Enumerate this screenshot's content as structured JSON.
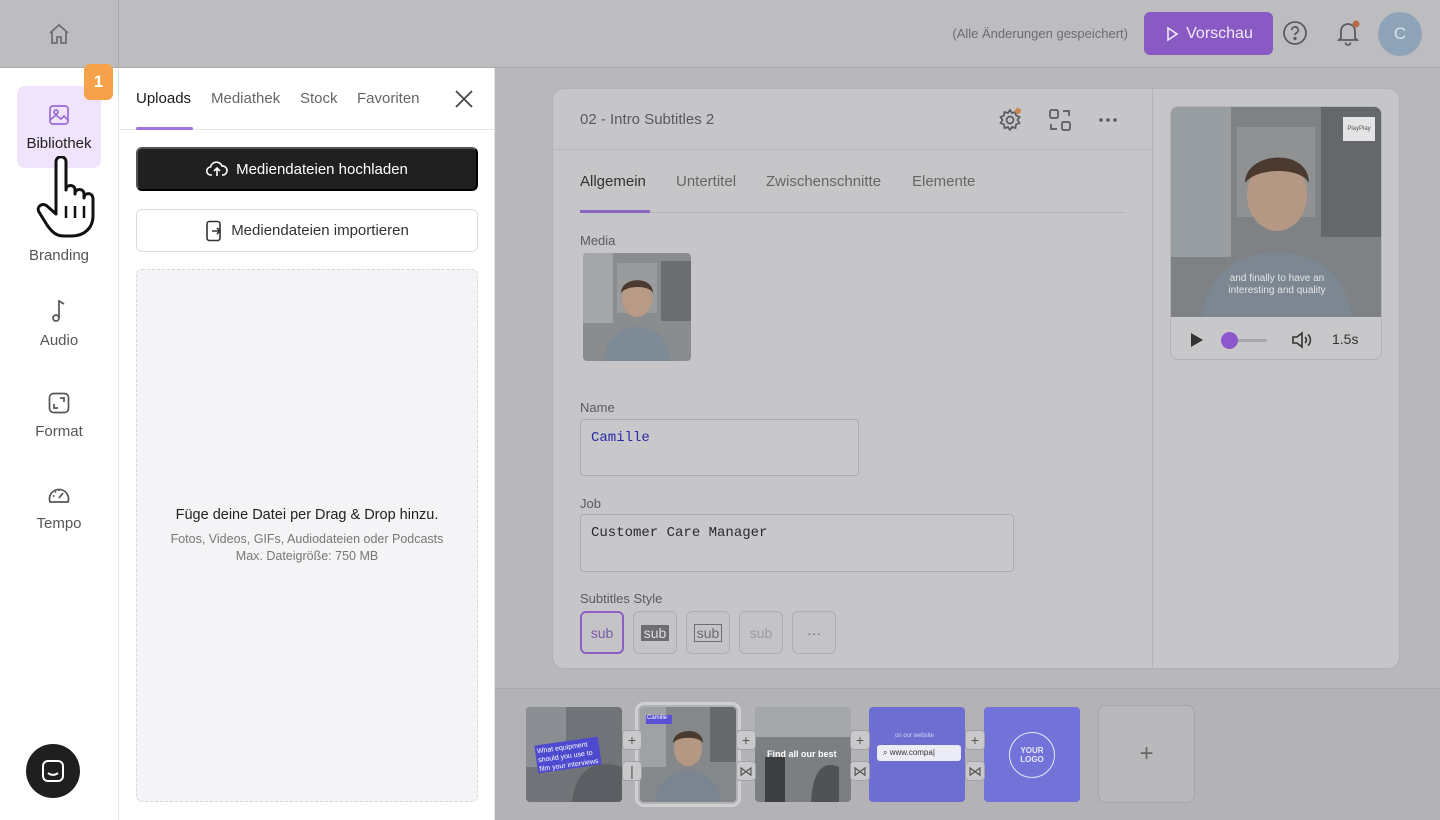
{
  "topbar": {
    "saved_status": "(Alle Änderungen gespeichert)",
    "preview_label": "Vorschau",
    "avatar_initial": "C"
  },
  "rail": {
    "badge": "1",
    "items": [
      {
        "label": "Bibliothek",
        "icon": "image-icon",
        "active": true
      },
      {
        "label": "Branding",
        "icon": "brush-icon"
      },
      {
        "label": "Audio",
        "icon": "music-note-icon"
      },
      {
        "label": "Format",
        "icon": "format-icon"
      },
      {
        "label": "Tempo",
        "icon": "speedometer-icon"
      }
    ]
  },
  "library": {
    "tabs": [
      "Uploads",
      "Mediathek",
      "Stock",
      "Favoriten"
    ],
    "upload_label": "Mediendateien hochladen",
    "import_label": "Mediendateien importieren",
    "dropzone_title": "Füge deine Datei per Drag & Drop hinzu.",
    "dropzone_types": "Fotos, Videos, GIFs, Audiodateien oder Podcasts",
    "dropzone_limit": "Max. Dateigröße: 750 MB"
  },
  "editor": {
    "scene_title": "02 - Intro Subtitles 2",
    "tabs": [
      "Allgemein",
      "Untertitel",
      "Zwischenschnitte",
      "Elemente"
    ],
    "media_label": "Media",
    "name_label": "Name",
    "name_value": "Camille",
    "job_label": "Job",
    "job_value": "Customer Care Manager",
    "subtitles_style_label": "Subtitles Style",
    "style_options": [
      "sub",
      "sub",
      "sub",
      "sub",
      "···"
    ]
  },
  "preview": {
    "caption_line1": "and finally to have an",
    "caption_line2": "interesting and quality",
    "logo_text": "PlayPlay",
    "time": "1.5s",
    "progress": 0.05
  },
  "timeline": {
    "clip1_caption": "What equipment should you use to film your interviews",
    "clip3_caption": "Find all our best",
    "clip4_small": "on our website",
    "clip4_url": "www.compa|",
    "clip5_logo": "YOUR LOGO",
    "clip2_name": "Camille"
  },
  "colors": {
    "accent": "#a372dc",
    "preview_button": "#8a5ac4",
    "badge": "#f6a24a"
  }
}
